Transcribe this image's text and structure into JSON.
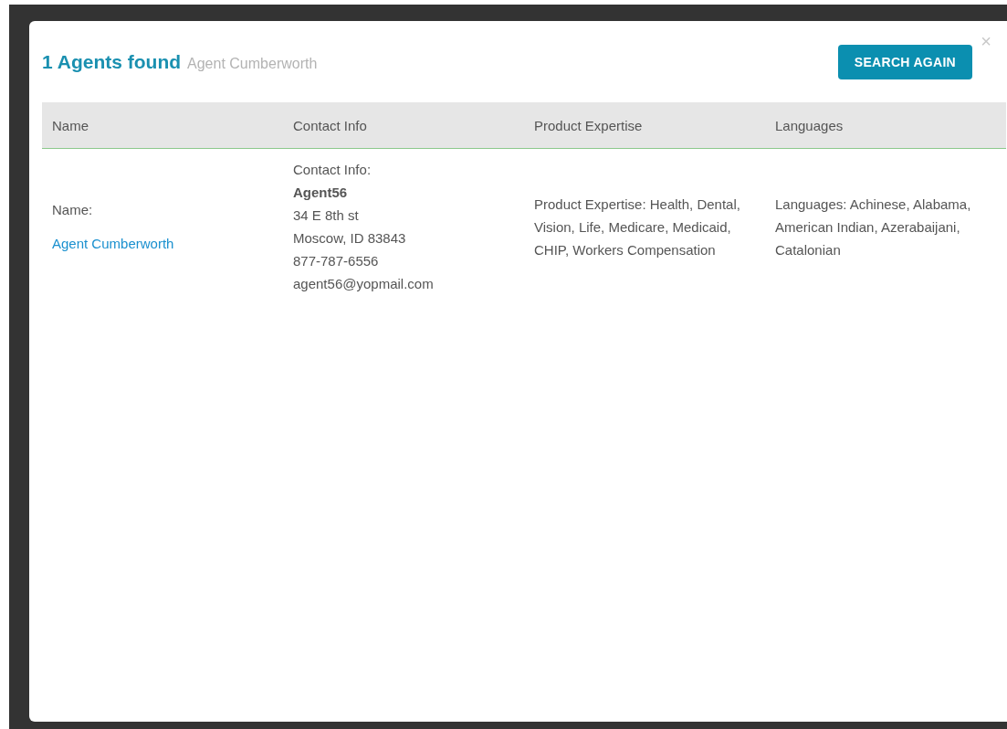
{
  "modal": {
    "count_title": "1 Agents found",
    "search_term": "Agent Cumberworth",
    "button": "SEARCH AGAIN",
    "close": "×"
  },
  "table": {
    "columns": [
      "Name",
      "Contact Info",
      "Product Expertise",
      "Languages"
    ],
    "rows": [
      {
        "name_label": "Name:",
        "name_link": "Agent Cumberworth",
        "contact_label": "Contact Info:",
        "contact_name": "Agent56",
        "contact_lines": [
          "34 E 8th st",
          "Moscow, ID 83843",
          "877-787-6556",
          "agent56@yopmail.com"
        ],
        "expertise": "Product Expertise: Health, Dental, Vision, Life, Medicare, Medicaid, CHIP, Workers Compensation",
        "languages": "Languages: Achinese, Alabama, American Indian, Azerabaijani, Catalonian"
      }
    ]
  }
}
